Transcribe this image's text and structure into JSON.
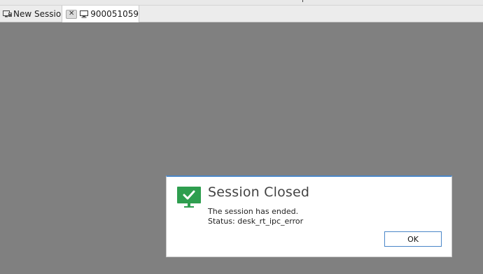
{
  "tabs": {
    "new_session_label": "New Session",
    "active_tab_label": "900051059",
    "close_glyph": "✕"
  },
  "dialog": {
    "title": "Session Closed",
    "message": "The session has ended.",
    "status": "Status: desk_rt_ipc_error",
    "ok_label": "OK",
    "icon": "monitor-check-icon"
  },
  "colors": {
    "background": "#808080",
    "accent": "#4a86c8",
    "success_green": "#2e9e4f"
  }
}
